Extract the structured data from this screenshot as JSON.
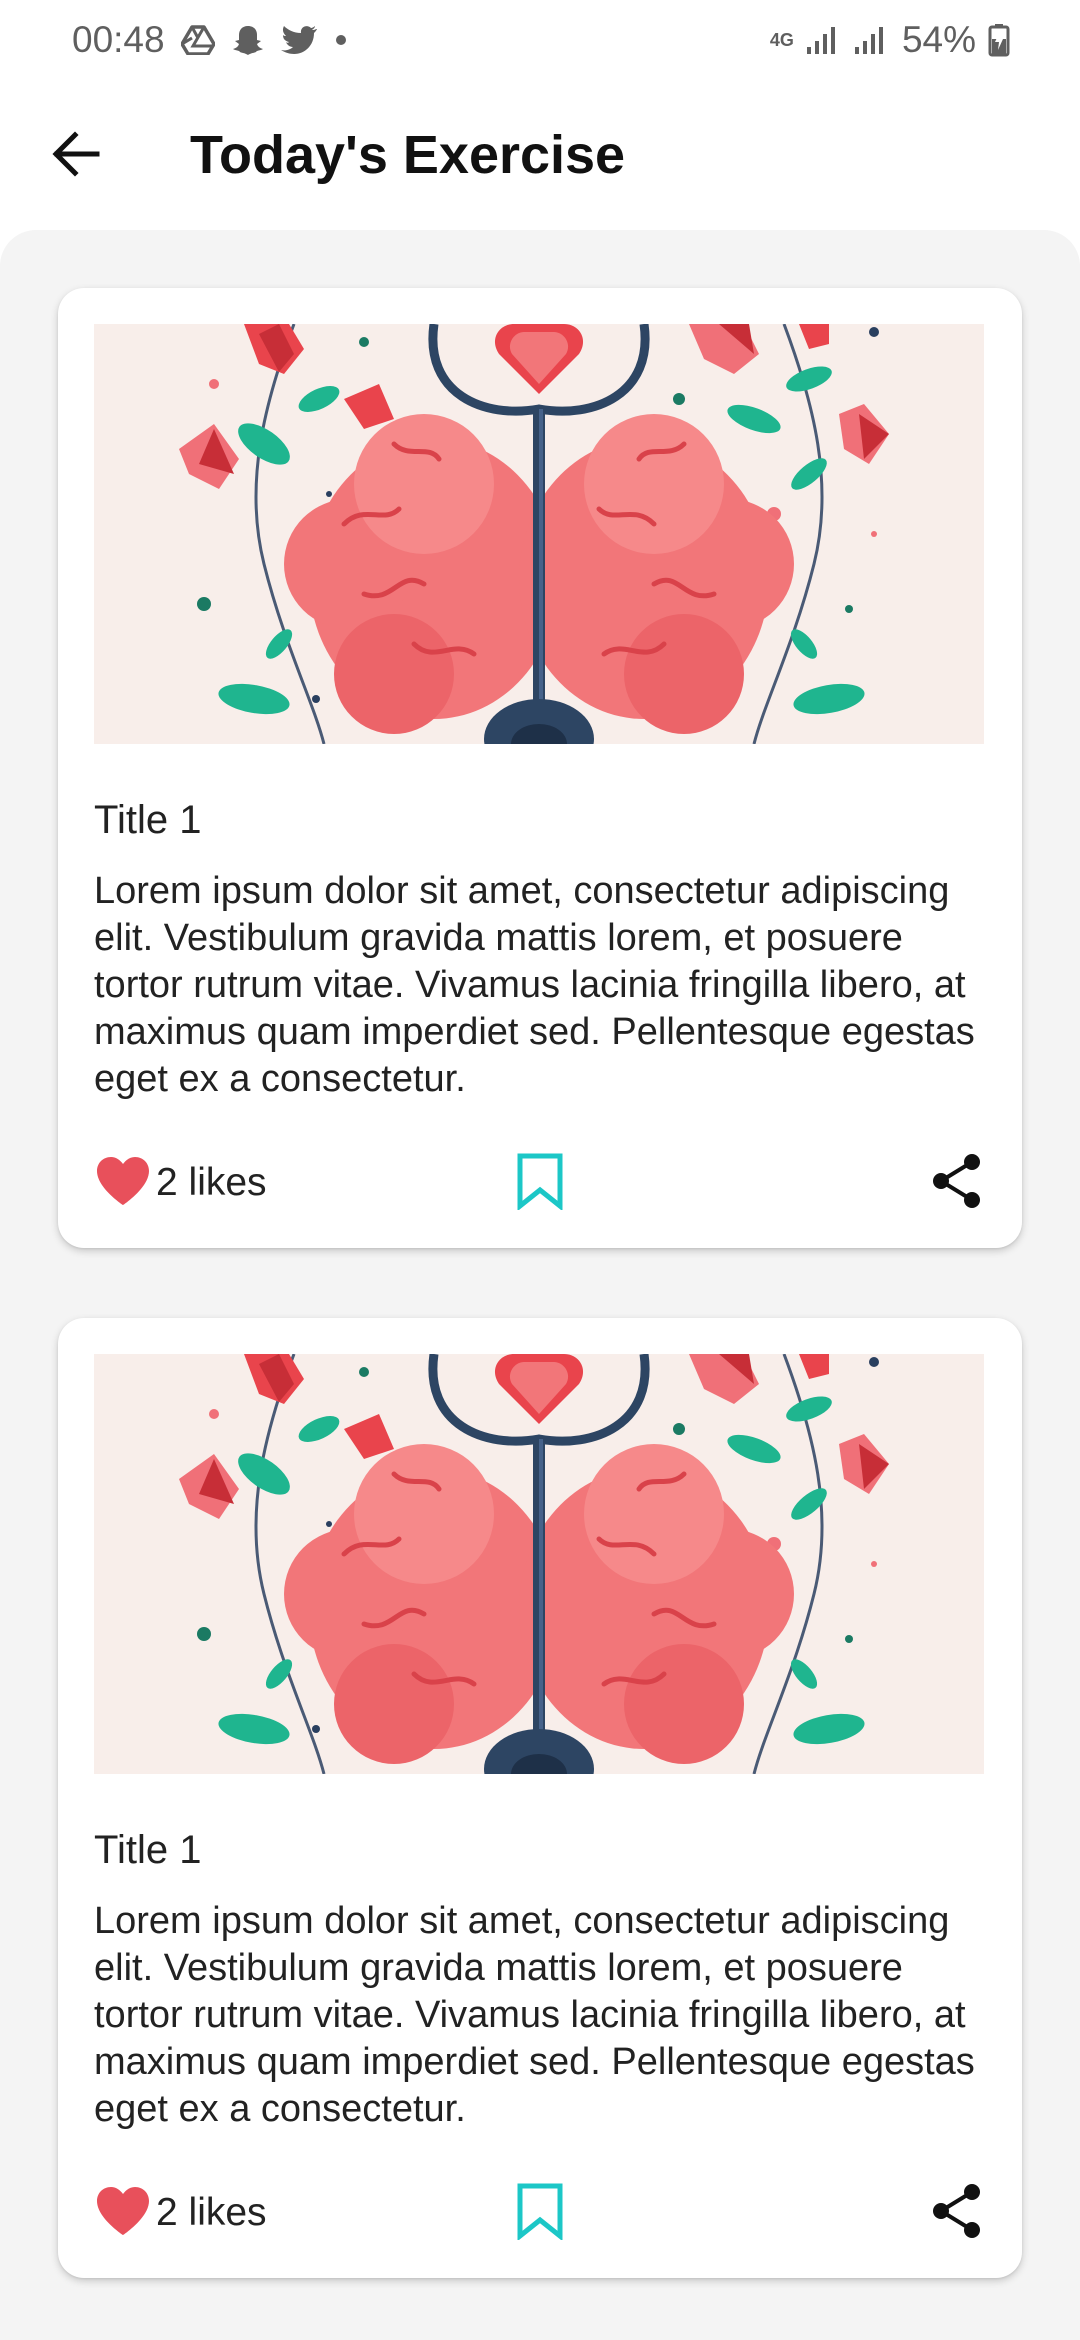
{
  "status_bar": {
    "time": "00:48",
    "network": "4G",
    "battery": "54%",
    "icons": [
      "drive-icon",
      "snapchat-icon",
      "twitter-icon",
      "dot-icon",
      "signal-icon",
      "battery-icon"
    ]
  },
  "app_bar": {
    "title": "Today's Exercise",
    "back_icon": "arrow-left-icon"
  },
  "cards": [
    {
      "title": "Title 1",
      "body": "Lorem ipsum dolor sit amet, consectetur adipiscing elit. Vestibulum gravida mattis lorem, et posuere tortor rutrum vitae. Vivamus lacinia fringilla libero, at maximus quam imperdiet sed. Pellentesque egestas eget ex a consectetur.",
      "likes": "2 likes",
      "image": "brain-stethoscope-illustration"
    },
    {
      "title": "Title 1",
      "body": "Lorem ipsum dolor sit amet, consectetur adipiscing elit. Vestibulum gravida mattis lorem, et posuere tortor rutrum vitae. Vivamus lacinia fringilla libero, at maximus quam imperdiet sed. Pellentesque egestas eget ex a consectetur.",
      "likes": "2 likes",
      "image": "brain-stethoscope-illustration"
    }
  ],
  "colors": {
    "heart": "#e8505b",
    "bookmark": "#1cc7c7",
    "content_bg": "#f4f4f4",
    "image_bg": "#f8eeea"
  }
}
